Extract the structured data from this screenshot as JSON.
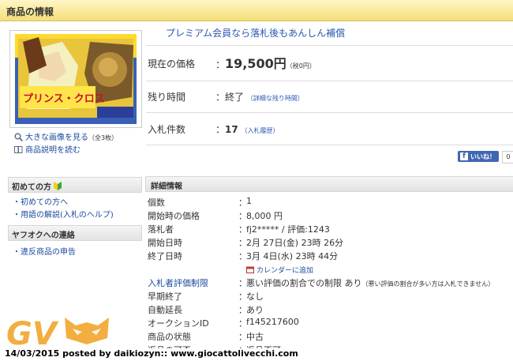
{
  "header": {
    "title": "商品の情報"
  },
  "image_panel": {
    "thumb_caption": "プリンス・クロス",
    "enlarge_label": "大きな画像を見る",
    "enlarge_count": "（全3枚）",
    "description_label": "商品説明を読む"
  },
  "premium_note": "プレミアム会員なら落札後もあんしん補償",
  "price": {
    "label": "現在の価格",
    "value": "19,500円",
    "tax": "（税0円）"
  },
  "remaining": {
    "label": "残り時間",
    "value": "終了",
    "link": "（詳細な残り時間）"
  },
  "bids": {
    "label": "入札件数",
    "value": "17",
    "link": "（入札履歴）"
  },
  "social": {
    "like_label": "いいね！",
    "like_count": "0"
  },
  "sidebar": {
    "beginner_title": "初めての方",
    "beginner_links": [
      "初めての方へ",
      "用語の解説(入札のヘルプ)"
    ],
    "contact_title": "ヤフオクへの連絡",
    "contact_links": [
      "違反商品の申告"
    ]
  },
  "detail": {
    "title": "詳細情報",
    "rows": [
      {
        "label": "個数",
        "value": "1"
      },
      {
        "label": "開始時の価格",
        "value": "8,000 円"
      },
      {
        "label": "落札者",
        "value": "fj2***** / 評価:1243"
      },
      {
        "label": "開始日時",
        "value": "2月 27日(金) 23時 26分"
      },
      {
        "label": "終了日時",
        "value": "3月 4日(水) 23時 44分"
      }
    ],
    "calendar_link": "カレンダーに追加",
    "rows2": [
      {
        "label": "入札者評価制限",
        "value": "悪い評価の割合での制限 あり",
        "note": "（悪い評価の割合が多い方は入札できません）"
      },
      {
        "label": "早期終了",
        "value": "なし"
      },
      {
        "label": "自動延長",
        "value": "あり"
      },
      {
        "label": "オークションID",
        "value": "f145217600"
      },
      {
        "label": "商品の状態",
        "value": "中古"
      },
      {
        "label": "返品の可否",
        "value": "返品不可"
      }
    ]
  },
  "watermark": {
    "logo_text": "GV",
    "posted": "14/03/2015 posted by daikiozyn:: www.giocattolivecchi.com"
  },
  "colors": {
    "header_gold": "#f5df78",
    "link_blue": "#1a4a9c",
    "facebook_blue": "#4267b2",
    "watermark_orange": "#f0a020"
  }
}
